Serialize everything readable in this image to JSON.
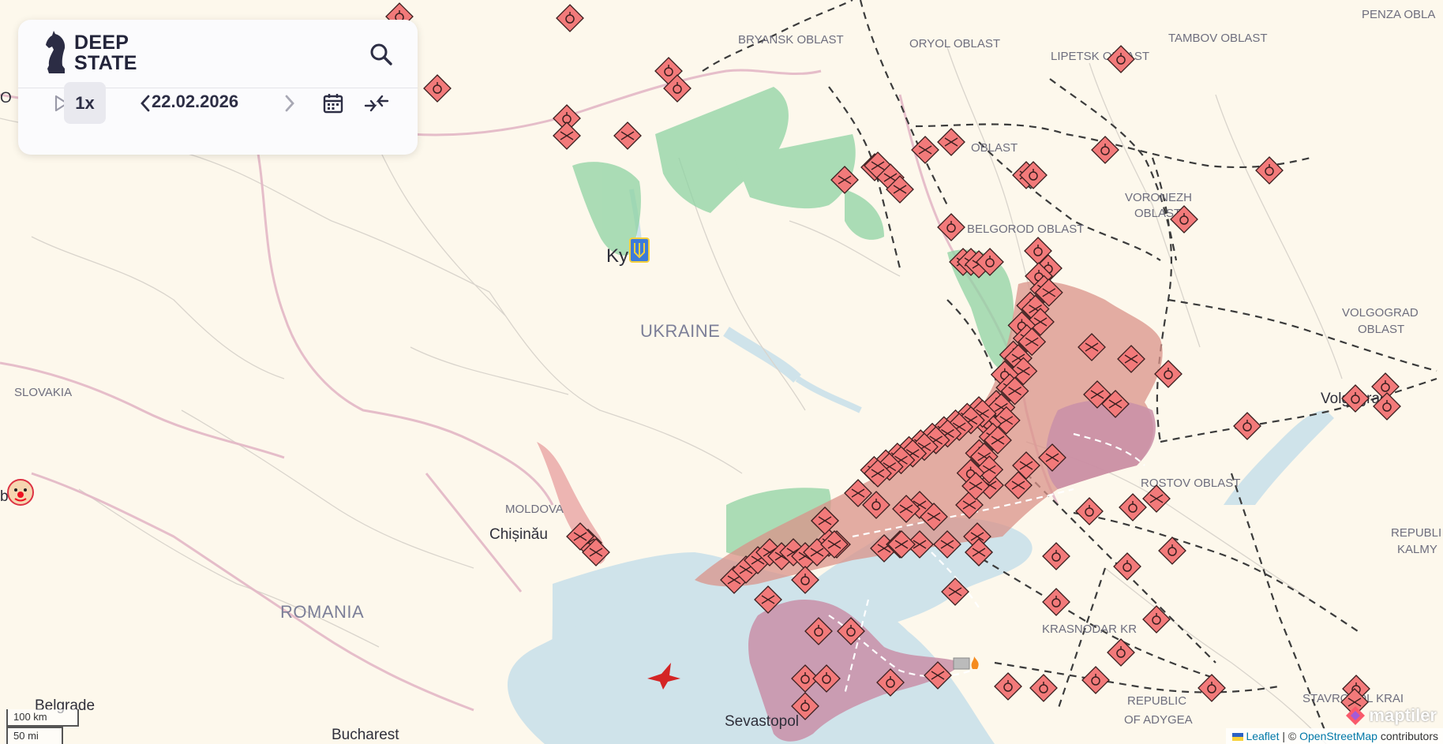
{
  "app": {
    "logo_text_line1": "DEEP",
    "logo_text_line2": "STATE"
  },
  "controls": {
    "speed_label": "1x",
    "date": "22.02.2026"
  },
  "map_labels": {
    "bryansk": "BRYANSK OBLAST",
    "oryol": "ORYOL OBLAST",
    "lipetsk": "LIPETSK OBLAST",
    "tambov": "TAMBOV OBLAST",
    "penza": "PENZA OBLA",
    "kursk": "OBLAST",
    "voronezh1": "VORONEZH",
    "voronezh2": "OBLAST",
    "belgorod": "BELGOROD OBLAST",
    "volgograd1": "VOLGOGRAD",
    "volgograd2": "OBLAST",
    "volgograd_city": "Volgograd",
    "rostov": "ROSTOV OBLAST",
    "republic_kalmykia1": "REPUBLI",
    "republic_kalmykia2": "KALMY",
    "krasnodar": "KRASNODAR KR",
    "adygea1": "REPUBLIC",
    "adygea2": "OF ADYGEA",
    "stavropol": "STAVROPOL KRAI",
    "ukraine": "UKRAINE",
    "kyiv": "Ky",
    "slovakia": "SLOVAKIA",
    "moldova": "MOLDOVA",
    "chisinau": "Chișinău",
    "romania": "ROMANIA",
    "belgrade": "Belgrade",
    "bucharest": "Bucharest",
    "sevastopol": "Sevastopol",
    "left_edge": "O",
    "left_edge2": "be"
  },
  "scale": {
    "km": "100 km",
    "mi": "50 mi"
  },
  "attribution": {
    "leaflet": "Leaflet",
    "separator": " | © ",
    "osm": "OpenStreetMap",
    "contributors": " contributors",
    "maptiler": "maptiler"
  },
  "colors": {
    "background": "#fdf8ec",
    "sea": "#cfe3ea",
    "occupied": "#d9938a",
    "crimea": "#c98fa8",
    "liberated": "#8fd3a3",
    "marker": "#f27a7a",
    "border": "#e3b7c6"
  },
  "icons": [
    "search-icon",
    "play-icon",
    "chevron-left-icon",
    "chevron-right-icon",
    "calendar-icon",
    "collapse-icon",
    "knight-logo-icon",
    "explosion-marker-icon",
    "crossed-marker-icon",
    "bird-icon",
    "clown-icon",
    "fire-icon",
    "trident-icon"
  ]
}
